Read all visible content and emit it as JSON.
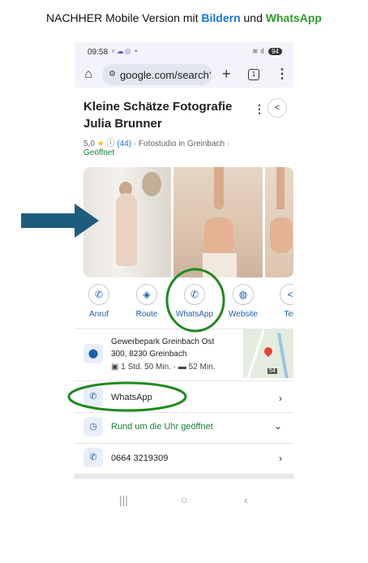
{
  "caption": {
    "prefix": "NACHHER Mobile Version mit ",
    "bilder": "Bildern",
    "und": " und ",
    "whatsapp": "WhatsApp",
    "blue": "#1a73e8",
    "green": "#2e9a2e"
  },
  "status_bar": {
    "time": "09:58",
    "notification_icons": "♆☁◎ •",
    "signal": "≋ ıl",
    "battery": "94"
  },
  "browser": {
    "home_icon": "home-icon",
    "url": "google.com/search?q",
    "new_tab_icon": "plus-icon",
    "tabs_count": "1",
    "menu_icon": "more-vert-icon"
  },
  "business": {
    "name": "Kleine Schätze Fotografie Julia Brunner",
    "rating": "5,0",
    "star": "★",
    "info_icon": "ⓘ",
    "reviews": "(44)",
    "category": "· Fotostudio in Greinbach ·",
    "open_status": "Geöffnet"
  },
  "actions": [
    {
      "label": "Anruf",
      "icon": "phone-icon"
    },
    {
      "label": "Route",
      "icon": "directions-icon"
    },
    {
      "label": "WhatsApp",
      "icon": "whatsapp-icon"
    },
    {
      "label": "Website",
      "icon": "globe-icon"
    },
    {
      "label": "Teil",
      "icon": "share-icon"
    }
  ],
  "address": {
    "line1": "Gewerbepark Greinbach Ost",
    "line2": "300, 8230 Greinbach",
    "transit_time": "1 Std. 50 Min.",
    "drive_time": "52 Min.",
    "map_route_label": "54"
  },
  "rows": {
    "whatsapp": "WhatsApp",
    "hours": "Rund um die Uhr geöffnet",
    "phone": "0664 3219309",
    "hours_color": "#188038"
  },
  "nav": {
    "recent": "|||",
    "home": "○",
    "back": "‹"
  },
  "colors": {
    "arrow": "#1e5c7e",
    "highlight_ring": "#1f8a1f",
    "action_blue": "#1a5fb4"
  }
}
